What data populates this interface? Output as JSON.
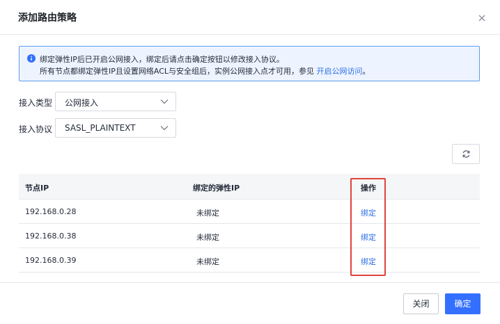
{
  "dialog": {
    "title": "添加路由策略"
  },
  "notice": {
    "line1": "绑定弹性IP后已开启公网接入，绑定后请点击确定按钮以修改接入协议。",
    "line2_prefix": "所有节点都绑定弹性IP且设置网络ACL与安全组后，实例公网接入点才可用，参见 ",
    "line2_link": "开启公网访问",
    "line2_suffix": "。",
    "icon": "info-icon"
  },
  "form": {
    "access_type_label": "接入类型",
    "access_type_value": "公网接入",
    "access_protocol_label": "接入协议",
    "access_protocol_value": "SASL_PLAINTEXT"
  },
  "table": {
    "columns": [
      "节点IP",
      "绑定的弹性IP",
      "操作"
    ],
    "rows": [
      {
        "ip": "192.168.0.28",
        "eip": "未绑定",
        "action": "绑定"
      },
      {
        "ip": "192.168.0.38",
        "eip": "未绑定",
        "action": "绑定"
      },
      {
        "ip": "192.168.0.39",
        "eip": "未绑定",
        "action": "绑定"
      }
    ]
  },
  "footer": {
    "close_label": "关闭",
    "ok_label": "确定"
  },
  "colors": {
    "primary": "#3370ff",
    "link": "#2d6fe6",
    "highlight": "#e2413b",
    "notice_bg": "#edf4ff",
    "notice_border": "#5e9cf0"
  }
}
